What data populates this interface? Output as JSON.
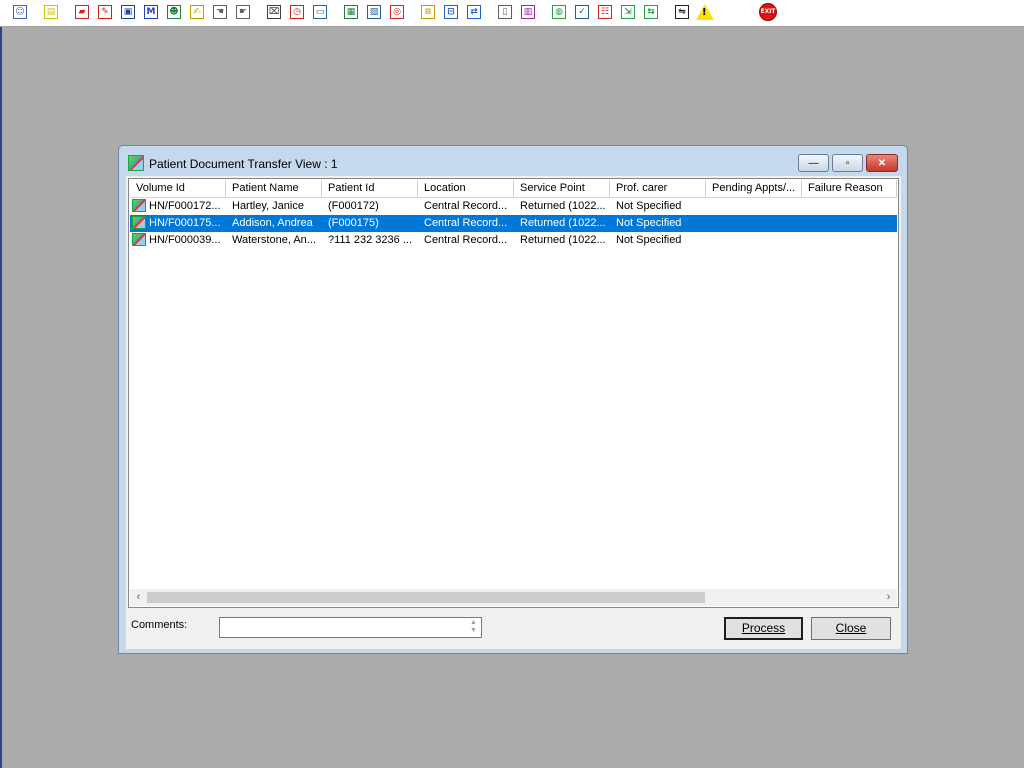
{
  "toolbar": {
    "groups": [
      [
        "person-icon"
      ],
      [
        "printer-icon"
      ],
      [
        "book-icon",
        "book-edit-icon",
        "screen-icon",
        "mail-m-icon",
        "person-card-icon",
        "document-pen-icon",
        "hand-left-icon",
        "hand-right-icon"
      ],
      [
        "scan-icon",
        "clock-icon",
        "window-icon"
      ],
      [
        "chart-card-icon",
        "card-edit-icon",
        "disc-icon"
      ],
      [
        "notes-icon",
        "car-icon",
        "transfer-person-icon"
      ],
      [
        "page-icon",
        "bar-chart-icon"
      ],
      [
        "globe-icon",
        "list-check-icon",
        "list-person-icon",
        "list-arrow-icon",
        "list-transfer-icon"
      ],
      [
        "exchange-icon",
        "warning-icon"
      ],
      [
        "exit-icon"
      ]
    ],
    "exit_label": "EXIT",
    "warning_glyph": "!"
  },
  "window": {
    "title": "Patient Document Transfer View : 1",
    "minimize_glyph": "—",
    "maximize_glyph": "▫",
    "close_glyph": "✕"
  },
  "table": {
    "columns": [
      "Volume Id",
      "Patient Name",
      "Patient Id",
      "Location",
      "Service Point",
      "Prof. carer",
      "Pending Appts/...",
      "Failure Reason"
    ],
    "rows": [
      {
        "cells": [
          "HN/F000172...",
          "Hartley, Janice",
          "(F000172)",
          "Central Record...",
          "Returned (1022...",
          "Not Specified",
          "",
          ""
        ],
        "selected": false
      },
      {
        "cells": [
          "HN/F000175...",
          "Addison, Andrea",
          "(F000175)",
          "Central Record...",
          "Returned (1022...",
          "Not Specified",
          "",
          ""
        ],
        "selected": true
      },
      {
        "cells": [
          "HN/F000039...",
          "Waterstone, An...",
          "?111 232 3236 ...",
          "Central Record...",
          "Returned (1022...",
          "Not Specified",
          "",
          ""
        ],
        "selected": false
      }
    ],
    "scroll_left": "‹",
    "scroll_right": "›"
  },
  "footer": {
    "comments_label": "Comments:",
    "comments_value": "",
    "process_label": "Process",
    "close_label": "Close"
  }
}
